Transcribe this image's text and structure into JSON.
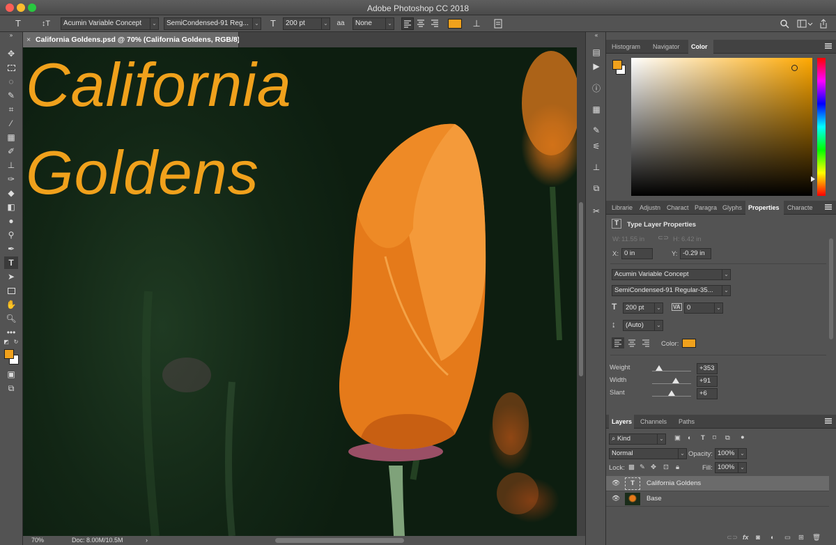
{
  "window": {
    "title": "Adobe Photoshop CC 2018"
  },
  "options_bar": {
    "tool_glyph": "T",
    "orient_glyph": "↕T",
    "font_family": "Acumin Variable Concept",
    "font_style": "SemiCondensed-91 Reg...",
    "size_glyph": "T",
    "font_size": "200 pt",
    "aa_glyph": "aa",
    "antialias": "None",
    "text_color": "#f0a11c"
  },
  "document": {
    "tab_title": "California Goldens.psd @ 70% (California  Goldens, RGB/8) *",
    "close_glyph": "×",
    "headline_line1": "California",
    "headline_line2": "Goldens",
    "text_color": "#f0a11c"
  },
  "statusbar": {
    "zoom": "70%",
    "doc_size": "Doc: 8.00M/10.5M",
    "arrow": "›"
  },
  "color_panel": {
    "tabs": [
      "Histogram",
      "Navigator",
      "Color"
    ],
    "active_tab": "Color",
    "foreground": "#f0a11c",
    "background": "#ffffff"
  },
  "properties_panel": {
    "tabs": [
      "Librarie",
      "Adjustn",
      "Charact",
      "Paragra",
      "Glyphs",
      "Properties",
      "Characte"
    ],
    "active_tab": "Properties",
    "header": "Type Layer Properties",
    "w_label": "W:",
    "w_value": "11.55 in",
    "h_label": "H:",
    "h_value": "6.42 in",
    "x_label": "X:",
    "x_value": "0 in",
    "y_label": "Y:",
    "y_value": "-0.29 in",
    "font_family": "Acumin Variable Concept",
    "font_style": "SemiCondensed-91 Regular-35...",
    "font_size": "200 pt",
    "tracking": "0",
    "leading": "(Auto)",
    "color_label": "Color:",
    "color_value": "#f0a11c",
    "axes": [
      {
        "label": "Weight",
        "value": "+353",
        "level": 0.18
      },
      {
        "label": "Width",
        "value": "+91",
        "level": 0.6
      },
      {
        "label": "Slant",
        "value": "+6",
        "level": 0.5
      }
    ]
  },
  "layers_panel": {
    "tabs": [
      "Layers",
      "Channels",
      "Paths"
    ],
    "active_tab": "Layers",
    "filter": "Kind",
    "blend_mode": "Normal",
    "opacity_label": "Opacity:",
    "opacity": "100%",
    "lock_label": "Lock:",
    "fill_label": "Fill:",
    "fill": "100%",
    "layers": [
      {
        "name": "California  Goldens",
        "thumb": "T",
        "selected": true
      },
      {
        "name": "Base",
        "thumb": "",
        "selected": false
      }
    ],
    "footer_icons": [
      "link",
      "fx",
      "mask",
      "adjustment",
      "group",
      "new",
      "delete"
    ],
    "fx_glyph": "fx"
  }
}
